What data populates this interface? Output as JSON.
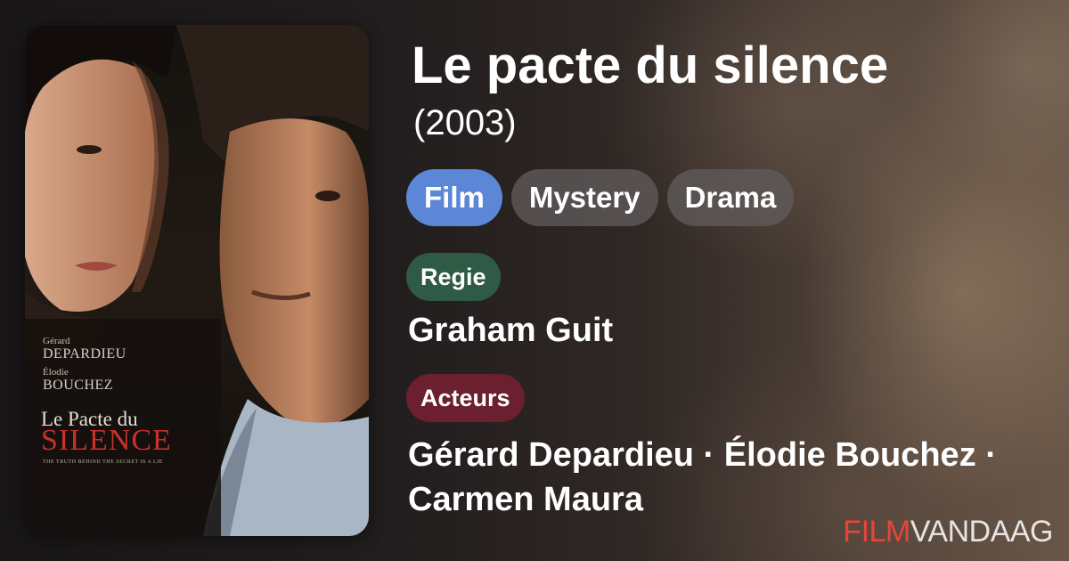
{
  "movie": {
    "title": "Le pacte du silence",
    "year": "(2003)"
  },
  "genres": [
    "Film",
    "Mystery",
    "Drama"
  ],
  "active_genre": "Film",
  "director_label": "Regie",
  "director": "Graham Guit",
  "cast_label": "Acteurs",
  "cast": "Gérard Depardieu · Élodie Bouchez · Carmen Maura",
  "poster": {
    "actor1_first": "Gérard",
    "actor1_last": "DEPARDIEU",
    "actor2_first": "Élodie",
    "actor2_last": "BOUCHEZ",
    "title_line1": "Le Pacte du",
    "title_line2": "SILENCE",
    "tagline": "THE TRUTH BEHIND THE SECRET IS A LIE"
  },
  "brand": {
    "part1": "FILM",
    "part2": "VANDAAG"
  },
  "colors": {
    "film_pill": "#5b87d6",
    "genre_pill": "#5f5a5a",
    "regie_label": "#2f5a45",
    "acteurs_label": "#6c1f2e",
    "brand_red": "#e8443a"
  }
}
